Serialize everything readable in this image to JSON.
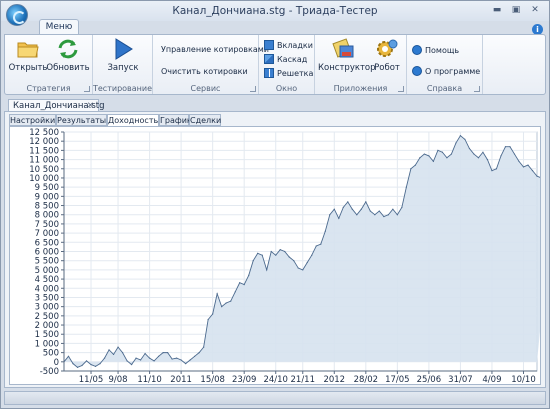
{
  "window": {
    "title": "Канал_Дончиана.stg - Триада-Тестер"
  },
  "menu": {
    "label": "Меню"
  },
  "ribbon": {
    "groups": {
      "strategy": {
        "label": "Стратегия",
        "open": "Открыть",
        "refresh": "Обновить"
      },
      "testing": {
        "label": "Тестирование",
        "run": "Запуск"
      },
      "service": {
        "label": "Сервис",
        "manage": "Управление котировками",
        "clear": "Очистить котировки"
      },
      "window": {
        "label": "Окно",
        "tabs": "Вкладки",
        "cascade": "Каскад",
        "grid": "Решетка"
      },
      "apps": {
        "label": "Приложения",
        "constructor": "Конструктор",
        "robot": "Робот"
      },
      "help": {
        "label": "Справка",
        "help": "Помощь",
        "about": "О программе"
      }
    }
  },
  "document": {
    "tab_label": "Канал_Дончиана.stg",
    "close": "✕"
  },
  "subtabs": [
    "Настройки",
    "Результаты",
    "Доходность",
    "График",
    "Сделки"
  ],
  "active_subtab": "Доходность",
  "colors": {
    "fill": "#d6e2ee",
    "line": "#4c6a8e"
  },
  "chart_data": {
    "type": "area",
    "title": "",
    "xlabel": "",
    "ylabel": "",
    "ylim": [
      -500,
      12500
    ],
    "yticks": [
      -500,
      0,
      500,
      1000,
      1500,
      2000,
      2500,
      3000,
      3500,
      4000,
      4500,
      5000,
      5500,
      6000,
      6500,
      7000,
      7500,
      8000,
      8500,
      9000,
      9500,
      10000,
      10500,
      11000,
      11500,
      12000,
      12500
    ],
    "ytick_labels": [
      "-500",
      "0",
      "500",
      "1 000",
      "1 500",
      "2 000",
      "2 500",
      "3 000",
      "3 500",
      "4 000",
      "4 500",
      "5 000",
      "5 500",
      "6 000",
      "6 500",
      "7 000",
      "7 500",
      "8 000",
      "8 500",
      "9 000",
      "9 500",
      "10 000",
      "10 500",
      "11 000",
      "11 500",
      "12 000",
      "12 500"
    ],
    "xticks": [
      {
        "label": "11/05",
        "pos": 6
      },
      {
        "label": "9/08",
        "pos": 12
      },
      {
        "label": "11/10",
        "pos": 19
      },
      {
        "label": "2011",
        "pos": 26
      },
      {
        "label": "15/08",
        "pos": 33
      },
      {
        "label": "23/09",
        "pos": 40
      },
      {
        "label": "24/10",
        "pos": 47
      },
      {
        "label": "21/11",
        "pos": 53
      },
      {
        "label": "2012",
        "pos": 60
      },
      {
        "label": "28/02",
        "pos": 67
      },
      {
        "label": "17/05",
        "pos": 74
      },
      {
        "label": "25/06",
        "pos": 81
      },
      {
        "label": "31/07",
        "pos": 88
      },
      {
        "label": "4/09",
        "pos": 95
      },
      {
        "label": "10/10",
        "pos": 102
      }
    ],
    "x_count": 106,
    "values": [
      0,
      300,
      -100,
      -300,
      -200,
      50,
      -150,
      -250,
      -100,
      200,
      650,
      400,
      800,
      500,
      50,
      -150,
      200,
      100,
      450,
      200,
      50,
      300,
      500,
      500,
      150,
      200,
      100,
      -100,
      100,
      300,
      500,
      800,
      2300,
      2600,
      3700,
      3000,
      3200,
      3300,
      3800,
      4300,
      4200,
      4700,
      5500,
      5900,
      5800,
      5000,
      6000,
      5800,
      6100,
      6000,
      5700,
      5500,
      5100,
      5000,
      5400,
      5800,
      6300,
      6400,
      7100,
      8000,
      8300,
      7800,
      8400,
      8700,
      8300,
      8000,
      8300,
      8700,
      8200,
      8000,
      8200,
      7900,
      8000,
      8300,
      8000,
      8400,
      9500,
      10500,
      10700,
      11100,
      11300,
      11200,
      10900,
      11500,
      11400,
      11100,
      11300,
      11900,
      12300,
      12100,
      11600,
      11300,
      11100,
      11400,
      11000,
      10400,
      10500,
      11200,
      11700,
      11700,
      11300,
      10900,
      10600,
      10700,
      10400,
      10100,
      10000,
      10200,
      10100,
      10000
    ]
  }
}
